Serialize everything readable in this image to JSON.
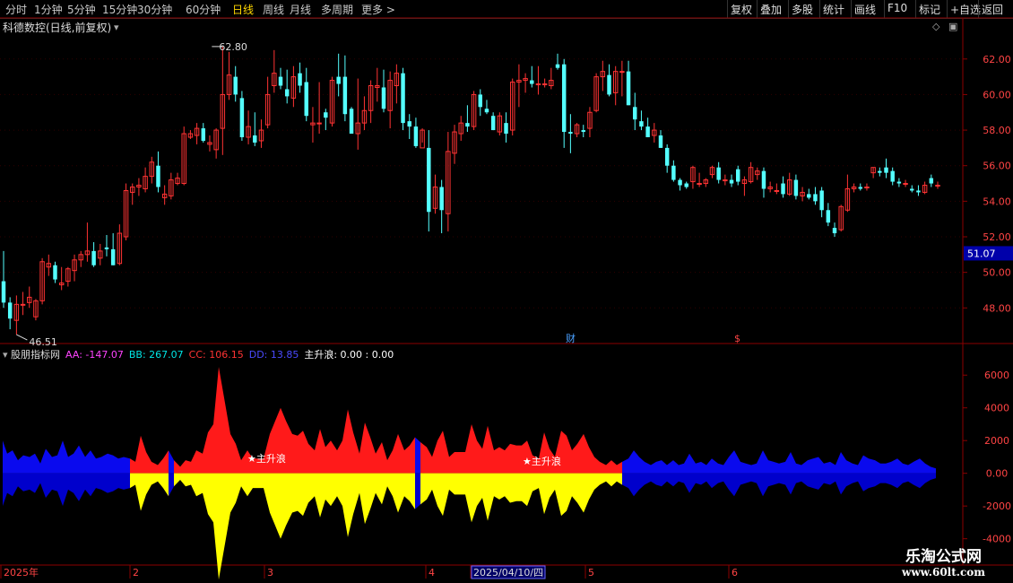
{
  "toolbar": {
    "periods": [
      "分时",
      "1分钟",
      "5分钟",
      "15分钟",
      "30分钟",
      "60分钟",
      "日线",
      "周线",
      "月线",
      "多周期",
      "更多 >"
    ],
    "active_period": "日线",
    "right_buttons": [
      "复权",
      "叠加",
      "多股",
      "统计",
      "画线",
      "F10",
      "标记",
      "+自选",
      "返回"
    ]
  },
  "main_panel": {
    "title": "科德数控(日线,前复权)",
    "price_tag": "51.07",
    "high_label": "62.80",
    "low_label": "46.51",
    "markers": [
      "财",
      "$"
    ]
  },
  "indicator_panel": {
    "name": "股朋指标网",
    "legend": [
      {
        "key": "AA",
        "value": "-147.07",
        "color": "#ff44ff"
      },
      {
        "key": "BB",
        "value": "267.07",
        "color": "#00e5e5"
      },
      {
        "key": "CC",
        "value": "106.15",
        "color": "#ff3333"
      },
      {
        "key": "DD",
        "value": "13.85",
        "color": "#4a4aff"
      },
      {
        "key": "主升浪",
        "value": "0.00 : 0.00",
        "color": "#ffffff"
      }
    ],
    "signal_label": "主升浪"
  },
  "date_axis": {
    "labels": [
      "2025年",
      "2",
      "3",
      "4",
      "2025/04/10/四",
      "5",
      "6"
    ]
  },
  "watermark": {
    "line1": "乐淘公式网",
    "line2": "www.60lt.com"
  },
  "chart_data": [
    {
      "type": "candlestick",
      "title": "科德数控(日线,前复权)",
      "y_ticks": [
        48.0,
        50.0,
        52.0,
        54.0,
        56.0,
        58.0,
        60.0,
        62.0
      ],
      "ylim": [
        46.3,
        63.3
      ],
      "up_color": "#ff3333",
      "down_color": "#54ffff",
      "last_price": 51.07,
      "ohlc": [
        [
          49.5,
          51.2,
          48.0,
          48.3
        ],
        [
          48.3,
          48.6,
          46.8,
          47.4
        ],
        [
          47.3,
          48.7,
          46.5,
          48.2
        ],
        [
          48.2,
          48.9,
          47.6,
          48.2
        ],
        [
          48.3,
          49.2,
          48.0,
          48.6
        ],
        [
          47.5,
          48.5,
          47.3,
          48.4
        ],
        [
          48.4,
          50.8,
          48.2,
          50.6
        ],
        [
          50.3,
          51.0,
          49.8,
          50.5
        ],
        [
          50.4,
          50.6,
          49.4,
          49.6
        ],
        [
          49.3,
          50.3,
          49.0,
          49.4
        ],
        [
          49.5,
          50.3,
          49.2,
          50.2
        ],
        [
          50.1,
          51.0,
          49.5,
          50.7
        ],
        [
          50.7,
          51.2,
          50.3,
          51.0
        ],
        [
          51.0,
          52.8,
          50.6,
          51.2
        ],
        [
          51.2,
          51.7,
          50.3,
          50.4
        ],
        [
          50.8,
          51.6,
          50.4,
          51.2
        ],
        [
          51.4,
          52.1,
          50.9,
          51.3
        ],
        [
          51.3,
          52.2,
          50.4,
          50.4
        ],
        [
          50.5,
          52.7,
          50.4,
          52.2
        ],
        [
          52.0,
          55.0,
          51.8,
          54.6
        ],
        [
          54.5,
          55.0,
          53.8,
          54.8
        ],
        [
          54.8,
          55.3,
          54.3,
          54.9
        ],
        [
          54.7,
          55.9,
          54.5,
          55.4
        ],
        [
          55.4,
          56.5,
          55.0,
          56.2
        ],
        [
          56.0,
          56.8,
          54.5,
          54.8
        ],
        [
          54.2,
          54.9,
          53.8,
          54.4
        ],
        [
          54.3,
          55.6,
          54.1,
          55.2
        ],
        [
          55.0,
          55.6,
          54.9,
          55.3
        ],
        [
          55.0,
          58.2,
          54.9,
          57.8
        ],
        [
          57.6,
          58.0,
          57.5,
          57.8
        ],
        [
          57.7,
          58.4,
          57.2,
          58.1
        ],
        [
          58.1,
          58.4,
          57.3,
          57.4
        ],
        [
          57.2,
          57.7,
          56.8,
          57.3
        ],
        [
          56.9,
          58.1,
          56.4,
          58.0
        ],
        [
          58.1,
          62.7,
          56.6,
          60.0
        ],
        [
          60.0,
          62.4,
          59.7,
          61.1
        ],
        [
          61.0,
          61.6,
          59.6,
          60.0
        ],
        [
          59.8,
          60.2,
          57.4,
          57.6
        ],
        [
          57.6,
          59.1,
          57.2,
          58.2
        ],
        [
          57.7,
          59.0,
          57.1,
          57.3
        ],
        [
          57.4,
          58.6,
          57.0,
          58.0
        ],
        [
          58.3,
          61.0,
          58.1,
          60.0
        ],
        [
          60.5,
          62.5,
          60.1,
          61.2
        ],
        [
          61.0,
          61.5,
          60.3,
          60.5
        ],
        [
          60.3,
          61.4,
          59.5,
          59.9
        ],
        [
          59.8,
          61.6,
          59.3,
          61.0
        ],
        [
          61.2,
          61.8,
          60.1,
          60.5
        ],
        [
          60.7,
          61.5,
          58.5,
          58.8
        ],
        [
          58.3,
          59.3,
          57.3,
          58.4
        ],
        [
          58.4,
          60.7,
          57.8,
          58.4
        ],
        [
          59.0,
          59.2,
          58.0,
          58.7
        ],
        [
          58.4,
          61.0,
          58.2,
          60.8
        ],
        [
          61.0,
          62.3,
          59.9,
          60.6
        ],
        [
          61.0,
          62.2,
          58.5,
          58.9
        ],
        [
          59.2,
          59.3,
          57.8,
          57.8
        ],
        [
          57.8,
          60.9,
          56.9,
          58.4
        ],
        [
          58.4,
          59.9,
          58.0,
          59.1
        ],
        [
          59.1,
          60.8,
          58.4,
          60.5
        ],
        [
          60.4,
          61.5,
          59.6,
          60.5
        ],
        [
          60.4,
          61.4,
          59.0,
          59.2
        ],
        [
          59.1,
          61.3,
          58.1,
          60.8
        ],
        [
          60.5,
          61.7,
          59.5,
          61.2
        ],
        [
          61.2,
          61.5,
          58.0,
          58.4
        ],
        [
          58.5,
          58.9,
          57.5,
          58.2
        ],
        [
          58.2,
          58.7,
          57.0,
          57.1
        ],
        [
          57.0,
          58.1,
          57.3,
          58.0
        ],
        [
          57.0,
          58.0,
          52.3,
          53.4
        ],
        [
          53.6,
          55.5,
          53.3,
          54.8
        ],
        [
          54.8,
          55.2,
          52.2,
          53.5
        ],
        [
          53.3,
          57.9,
          52.3,
          56.8
        ],
        [
          56.7,
          58.3,
          56.1,
          57.9
        ],
        [
          57.8,
          58.8,
          57.4,
          58.4
        ],
        [
          58.4,
          59.4,
          57.9,
          58.2
        ],
        [
          58.2,
          60.2,
          58.0,
          60.0
        ],
        [
          60.0,
          60.3,
          58.8,
          59.3
        ],
        [
          59.2,
          59.7,
          58.9,
          59.0
        ],
        [
          58.8,
          59.0,
          58.0,
          58.0
        ],
        [
          57.9,
          59.0,
          57.7,
          58.8
        ],
        [
          58.4,
          59.0,
          57.3,
          57.8
        ],
        [
          58.0,
          60.9,
          57.7,
          60.7
        ],
        [
          60.7,
          61.7,
          59.3,
          60.8
        ],
        [
          60.8,
          61.2,
          60.1,
          60.9
        ],
        [
          60.8,
          61.6,
          60.4,
          60.6
        ],
        [
          60.6,
          61.6,
          60.0,
          60.6
        ],
        [
          60.6,
          60.9,
          60.4,
          60.6
        ],
        [
          60.5,
          61.5,
          60.3,
          60.8
        ],
        [
          61.7,
          62.3,
          61.4,
          61.5
        ],
        [
          61.7,
          62.0,
          57.0,
          57.9
        ],
        [
          57.9,
          58.9,
          56.7,
          57.8
        ],
        [
          57.8,
          58.4,
          57.6,
          58.3
        ],
        [
          58.0,
          58.3,
          57.6,
          57.9
        ],
        [
          58.1,
          59.3,
          57.6,
          59.0
        ],
        [
          59.1,
          61.2,
          59.0,
          61.0
        ],
        [
          61.0,
          61.9,
          60.2,
          61.3
        ],
        [
          61.1,
          61.7,
          59.9,
          60.0
        ],
        [
          60.1,
          61.6,
          59.4,
          61.3
        ],
        [
          61.3,
          61.9,
          59.9,
          61.3
        ],
        [
          61.3,
          61.9,
          59.4,
          59.4
        ],
        [
          59.3,
          60.1,
          58.0,
          58.6
        ],
        [
          58.5,
          59.1,
          58.0,
          58.2
        ],
        [
          58.2,
          58.7,
          57.6,
          57.6
        ],
        [
          57.7,
          58.4,
          57.3,
          58.0
        ],
        [
          57.7,
          58.0,
          57.0,
          57.0
        ],
        [
          57.0,
          57.2,
          55.6,
          56.0
        ],
        [
          56.0,
          56.3,
          55.1,
          55.2
        ],
        [
          55.2,
          55.3,
          54.6,
          54.9
        ],
        [
          55.0,
          55.1,
          54.7,
          54.8
        ],
        [
          55.1,
          56.0,
          54.7,
          55.9
        ],
        [
          55.0,
          55.6,
          54.8,
          55.0
        ],
        [
          55.0,
          55.3,
          54.8,
          55.2
        ],
        [
          55.5,
          56.0,
          55.3,
          55.9
        ],
        [
          55.9,
          56.2,
          55.0,
          55.2
        ],
        [
          55.2,
          55.5,
          54.9,
          55.2
        ],
        [
          55.2,
          55.5,
          54.8,
          55.0
        ],
        [
          55.8,
          56.0,
          54.9,
          55.1
        ],
        [
          55.0,
          55.4,
          54.3,
          55.2
        ],
        [
          55.1,
          56.2,
          55.0,
          55.9
        ],
        [
          55.5,
          55.9,
          55.2,
          55.7
        ],
        [
          55.7,
          55.9,
          54.2,
          54.7
        ],
        [
          54.7,
          55.1,
          54.5,
          54.8
        ],
        [
          54.6,
          55.0,
          54.4,
          54.6
        ],
        [
          55.0,
          55.4,
          54.2,
          54.4
        ],
        [
          54.4,
          55.6,
          54.3,
          55.2
        ],
        [
          55.2,
          55.5,
          54.1,
          54.3
        ],
        [
          54.3,
          54.8,
          54.0,
          54.5
        ],
        [
          54.4,
          54.7,
          54.1,
          54.2
        ],
        [
          54.4,
          54.8,
          53.8,
          54.0
        ],
        [
          54.6,
          54.8,
          53.1,
          53.5
        ],
        [
          53.5,
          53.9,
          52.6,
          52.8
        ],
        [
          52.5,
          52.8,
          52.0,
          52.2
        ],
        [
          52.4,
          53.8,
          52.3,
          53.7
        ],
        [
          53.5,
          55.5,
          53.4,
          54.7
        ],
        [
          54.7,
          55.0,
          54.5,
          54.8
        ],
        [
          54.8,
          55.0,
          54.6,
          54.7
        ],
        [
          54.8,
          55.0,
          54.6,
          54.8
        ],
        [
          55.6,
          55.9,
          55.3,
          55.9
        ],
        [
          55.7,
          55.9,
          55.4,
          55.6
        ],
        [
          55.9,
          56.4,
          55.3,
          55.6
        ],
        [
          55.7,
          55.9,
          54.9,
          55.1
        ],
        [
          55.1,
          55.3,
          54.8,
          55.0
        ],
        [
          55.0,
          55.2,
          54.8,
          55.0
        ],
        [
          54.7,
          54.9,
          54.5,
          54.6
        ],
        [
          54.6,
          54.9,
          54.3,
          54.5
        ],
        [
          54.5,
          55.1,
          54.4,
          54.9
        ],
        [
          55.3,
          55.5,
          54.8,
          55.0
        ],
        [
          54.9,
          55.1,
          54.7,
          54.9
        ]
      ]
    },
    {
      "type": "area",
      "title": "股朋指标网",
      "y_ticks": [
        6000,
        4000,
        2000,
        0,
        -2000,
        -4000
      ],
      "ylim": [
        -5500,
        7000
      ],
      "series": [
        {
          "name": "AA",
          "color": "#ff44ff"
        },
        {
          "name": "BB",
          "color": "#00e5e5"
        },
        {
          "name": "CC",
          "color": "#ff3333"
        },
        {
          "name": "DD",
          "color": "#4a4aff"
        }
      ],
      "mirror_color": "#ffff00",
      "blue_color": "#0000ee",
      "x_positions": [
        3,
        8,
        14,
        20,
        26,
        33,
        39,
        45,
        51,
        58,
        64,
        70,
        76,
        82,
        88,
        95,
        101,
        107,
        113,
        120,
        126,
        132,
        138,
        145,
        151,
        157,
        163,
        169,
        176,
        182,
        188,
        194,
        201,
        207,
        213,
        219,
        226,
        232,
        238,
        244,
        251,
        257,
        263,
        269,
        276,
        282,
        288,
        294,
        301,
        307,
        313,
        319,
        326,
        332,
        338,
        344,
        351,
        357,
        363,
        369,
        376,
        382,
        388,
        394,
        401,
        407,
        413,
        419,
        426,
        432,
        438,
        444,
        451,
        457,
        463,
        469,
        476,
        482,
        488,
        494,
        501,
        507,
        513,
        519,
        526,
        532,
        538,
        544,
        551,
        557,
        563,
        569,
        576,
        582,
        588,
        594,
        601,
        607,
        613,
        619,
        626,
        632,
        638,
        644,
        651,
        657,
        663,
        669,
        676,
        682,
        688,
        694,
        701,
        707,
        713,
        719,
        726,
        732,
        738,
        744,
        751,
        757,
        763,
        769,
        776,
        782,
        788,
        794,
        801,
        807,
        813,
        819,
        826,
        832,
        838,
        844,
        851,
        857,
        863,
        869,
        876,
        882,
        888,
        894,
        901,
        907,
        913,
        919,
        926,
        932,
        938,
        944,
        951,
        957,
        963,
        969,
        976,
        982,
        988,
        994,
        1001,
        1007,
        1013,
        1019,
        1026,
        1032,
        1038,
        1044
      ],
      "values": [
        2000,
        1200,
        1400,
        800,
        1100,
        1000,
        1200,
        600,
        1500,
        1000,
        1100,
        2000,
        1000,
        1200,
        1700,
        1000,
        1400,
        900,
        1000,
        1200,
        1100,
        900,
        1000,
        900,
        700,
        2300,
        1300,
        700,
        500,
        900,
        1400,
        -800,
        400,
        800,
        700,
        1400,
        1200,
        2500,
        3000,
        6500,
        4300,
        2400,
        1800,
        800,
        1400,
        900,
        900,
        900,
        2400,
        3200,
        4000,
        3200,
        2400,
        2300,
        2600,
        1800,
        1400,
        2700,
        1600,
        2000,
        1400,
        2000,
        3900,
        2500,
        1200,
        3100,
        2200,
        1200,
        1900,
        800,
        1400,
        2400,
        1400,
        1700,
        2200,
        -1900,
        1600,
        1000,
        2000,
        2600,
        1000,
        1300,
        1300,
        1300,
        3000,
        2000,
        1500,
        2900,
        1400,
        1600,
        1400,
        1800,
        1700,
        1700,
        2000,
        1100,
        900,
        2500,
        1500,
        1000,
        2600,
        2300,
        1400,
        1800,
        2400,
        1600,
        1000,
        700,
        500,
        800,
        500,
        700,
        -900,
        -1400,
        -1000,
        -700,
        -500,
        -700,
        -800,
        -500,
        -800,
        -500,
        -600,
        -1200,
        -600,
        -700,
        -500,
        -900,
        -600,
        -500,
        -1000,
        -1400,
        -700,
        -600,
        -500,
        -600,
        -1400,
        -800,
        -700,
        -600,
        -700,
        -1300,
        -600,
        -500,
        -800,
        -900,
        -1000,
        -600,
        -700,
        -500,
        -1300,
        -800,
        -600,
        -500,
        -1100,
        -900,
        -800,
        -600,
        -600,
        -700,
        -900,
        -600,
        -500,
        -700,
        -900,
        -600,
        -400,
        -300
      ]
    }
  ]
}
